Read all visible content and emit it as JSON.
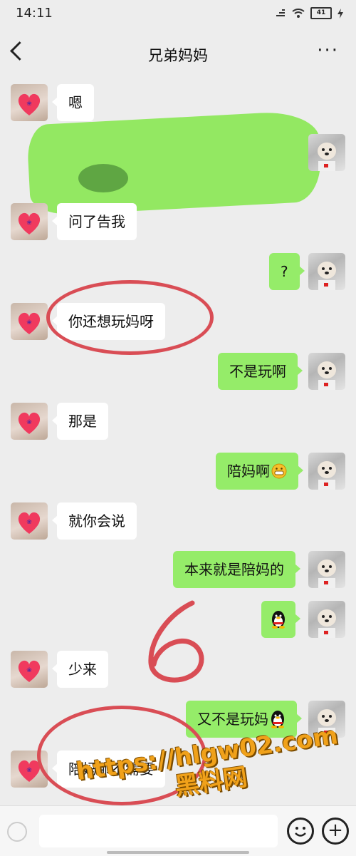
{
  "status_bar": {
    "time": "14:11",
    "battery": "41"
  },
  "header": {
    "title": "兄弟妈妈"
  },
  "messages": [
    {
      "side": "left",
      "text": "嗯"
    },
    {
      "side": "right",
      "text": ""
    },
    {
      "side": "left",
      "text": "问了告我"
    },
    {
      "side": "right",
      "text": "?"
    },
    {
      "side": "left",
      "text": "你还想玩妈呀"
    },
    {
      "side": "right",
      "text": "不是玩啊"
    },
    {
      "side": "left",
      "text": "那是"
    },
    {
      "side": "right",
      "text": "陪妈啊"
    },
    {
      "side": "left",
      "text": "就你会说"
    },
    {
      "side": "right",
      "text": "本来就是陪妈的"
    },
    {
      "side": "right",
      "text": ""
    },
    {
      "side": "left",
      "text": "少来"
    },
    {
      "side": "right",
      "text": "又不是玩妈"
    },
    {
      "side": "left",
      "text": "陪妈那不需要"
    }
  ],
  "annotation": {
    "number": "6"
  },
  "watermark": {
    "line1": "https://hlgw02.com",
    "line2": "黑料网"
  },
  "icons": {
    "back": "back-arrow-icon",
    "more": "more-dots-icon",
    "emoji": "emoji-icon",
    "plus": "plus-icon",
    "voice": "voice-icon"
  },
  "colors": {
    "bubble_right": "#95ec69",
    "bubble_left": "#ffffff",
    "background": "#ededed",
    "annotation": "#d94d55",
    "watermark": "#f0a11a"
  }
}
